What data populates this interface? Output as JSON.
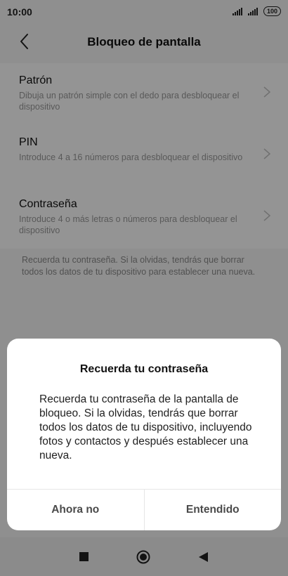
{
  "status": {
    "time": "10:00",
    "battery": "100"
  },
  "header": {
    "title": "Bloqueo de pantalla"
  },
  "options": [
    {
      "title": "Patrón",
      "desc": "Dibuja un patrón simple con el dedo para desbloquear el dispositivo"
    },
    {
      "title": "PIN",
      "desc": "Introduce 4 a 16 números para desbloquear el dispositivo"
    },
    {
      "title": "Contraseña",
      "desc": "Introduce 4 o más letras o números para desbloquear el dispositivo"
    }
  ],
  "hint": "Recuerda tu contraseña. Si la olvidas, tendrás que borrar todos los datos de tu dispositivo para establecer una nueva.",
  "dialog": {
    "title": "Recuerda tu contraseña",
    "message": "Recuerda tu contraseña de la pantalla de bloqueo. Si la olvidas, tendrás que borrar todos los datos de tu dispositivo, incluyendo fotos y contactos y después establecer una nueva.",
    "negative": "Ahora no",
    "positive": "Entendido"
  },
  "colors": {
    "overlay": "#000000",
    "dialog": "#ffffff",
    "text": "#111111"
  }
}
